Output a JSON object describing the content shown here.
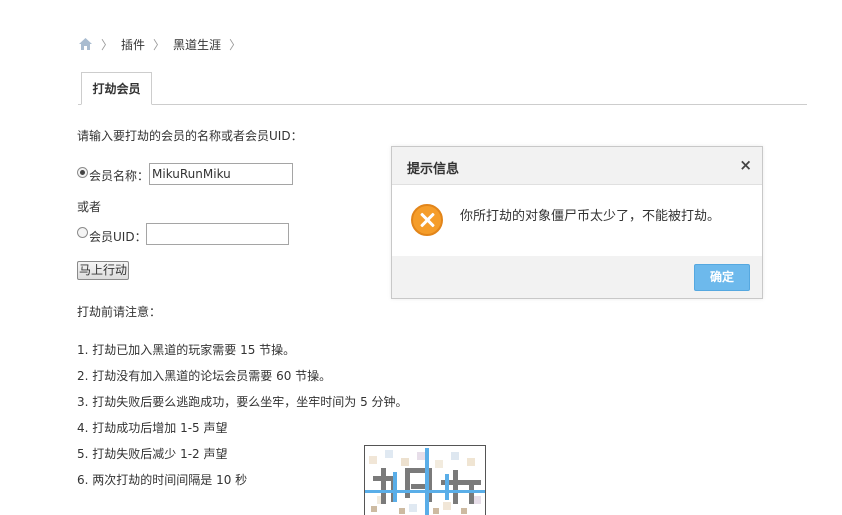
{
  "breadcrumb": {
    "items": [
      "插件",
      "黑道生涯"
    ],
    "separator": "〉"
  },
  "tabs": [
    {
      "label": "打劫会员",
      "active": true
    }
  ],
  "form": {
    "intro": "请输入要打劫的会员的名称或者会员UID：",
    "name_label": "会员名称：",
    "name_value": "MikuRunMiku",
    "or_text": "或者",
    "uid_label": "会员UID：",
    "uid_value": "",
    "submit_label": "马上行动",
    "selected_option": "name"
  },
  "notes": {
    "heading": "打劫前请注意：",
    "items": [
      "1. 打劫已加入黑道的玩家需要 15 节操。",
      "2. 打劫没有加入黑道的论坛会员需要 60 节操。",
      "3. 打劫失败后要么逃跑成功，要么坐牢，坐牢时间为 5 分钟。",
      "4. 打劫成功后增加 1-5 声望",
      "5. 打劫失败后减少 1-2 声望",
      "6. 两次打劫的时间间隔是 10 秒"
    ]
  },
  "dialog": {
    "title": "提示信息",
    "close_glyph": "×",
    "message": "你所打劫的对象僵尸币太少了，不能被打劫。",
    "ok_label": "确定",
    "icon": "error-x-icon"
  },
  "colors": {
    "accent_button": "#6db9ec",
    "warning_icon": "#f59d2a"
  }
}
